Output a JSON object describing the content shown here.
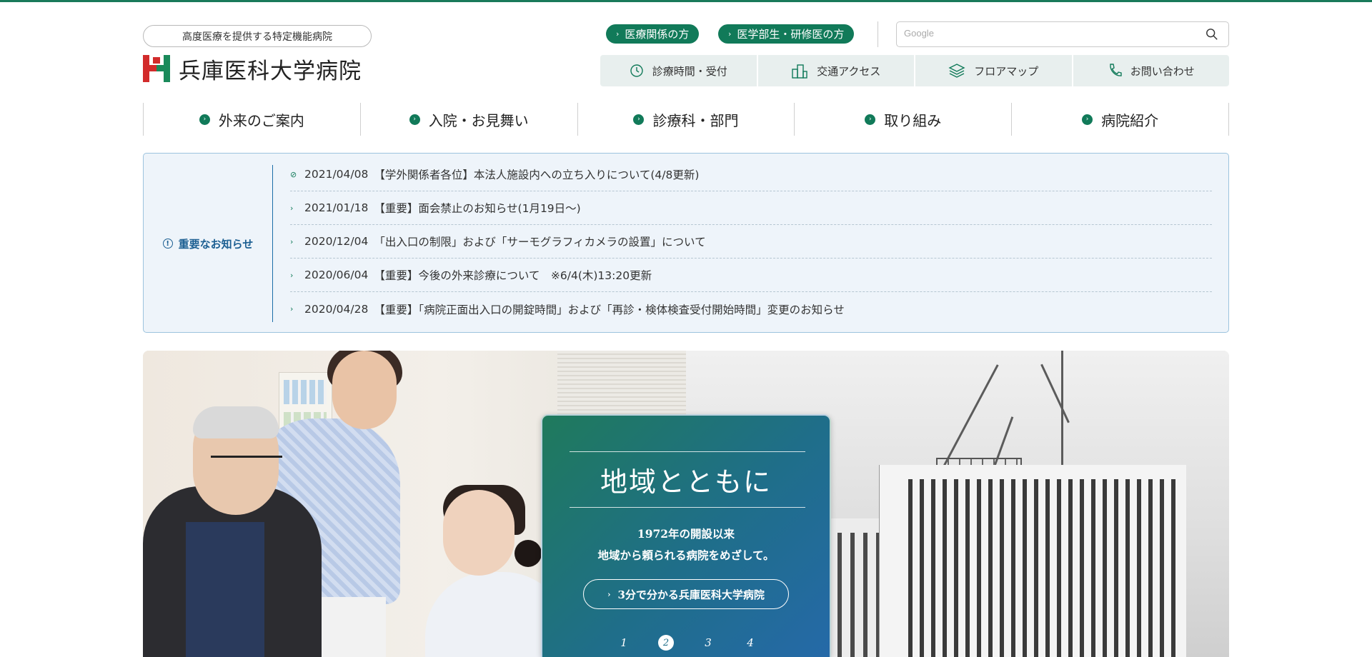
{
  "header": {
    "tagline": "高度医療を提供する特定機能病院",
    "logo_text": "兵庫医科大学病院",
    "audience_links": [
      {
        "label": "医療関係の方"
      },
      {
        "label": "医学部生・研修医の方"
      }
    ],
    "search": {
      "placeholder": "Google",
      "value": ""
    },
    "utility_links": [
      {
        "label": "診療時間・受付",
        "icon": "clock-icon"
      },
      {
        "label": "交通アクセス",
        "icon": "building-icon"
      },
      {
        "label": "フロアマップ",
        "icon": "layers-icon"
      },
      {
        "label": "お問い合わせ",
        "icon": "phone-icon"
      }
    ]
  },
  "main_nav": [
    {
      "label": "外来のご案内"
    },
    {
      "label": "入院・お見舞い"
    },
    {
      "label": "診療科・部門"
    },
    {
      "label": "取り組み"
    },
    {
      "label": "病院紹介"
    }
  ],
  "notices": {
    "heading": "重要なお知らせ",
    "items": [
      {
        "date": "2021/04/08",
        "text": "【学外関係者各位】本法人施設内への立ち入りについて(4/8更新)",
        "icon": "link-icon"
      },
      {
        "date": "2021/01/18",
        "text": "【重要】面会禁止のお知らせ(1月19日～)",
        "icon": "chevron-right-icon"
      },
      {
        "date": "2020/12/04",
        "text": "「出入口の制限」および「サーモグラフィカメラの設置」について",
        "icon": "chevron-right-icon"
      },
      {
        "date": "2020/06/04",
        "text": "【重要】今後の外来診療について　※6/4(木)13:20更新",
        "icon": "chevron-right-icon"
      },
      {
        "date": "2020/04/28",
        "text": "【重要】「病院正面出入口の開錠時間」および「再診・検体検査受付開始時間」変更のお知らせ",
        "icon": "chevron-right-icon"
      }
    ]
  },
  "hero": {
    "title": "地域とともに",
    "subtitle_line1": "1972年の開設以来",
    "subtitle_line2": "地域から頼られる病院をめざして。",
    "cta_label": "3分で分かる兵庫医科大学病院",
    "pager": [
      "1",
      "2",
      "3",
      "4"
    ],
    "pager_active": "2"
  },
  "colors": {
    "brand_green": "#117a59",
    "notice_blue": "#1c5f92",
    "logo_red": "#d22b2b"
  }
}
